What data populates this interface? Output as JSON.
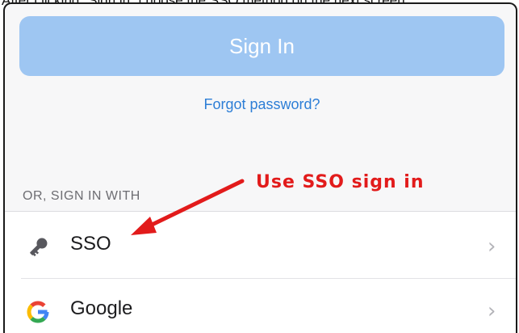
{
  "caption": "After clicking \"Sign in\" choose the SSO method on the next screen",
  "signin": {
    "button_label": "Sign In"
  },
  "forgot_password": "Forgot password?",
  "alt_signin": {
    "section_label": "OR, SIGN IN WITH",
    "providers": [
      {
        "label": "SSO",
        "icon": "key-icon"
      },
      {
        "label": "Google",
        "icon": "google-icon"
      }
    ]
  },
  "annotation": {
    "text": "Use SSO sign in",
    "color": "#e21b1b"
  },
  "colors": {
    "primary_button": "#9ec6f2",
    "link": "#2d7ed6",
    "background": "#f7f7f8",
    "chevron": "#b3b3b8"
  },
  "icons": {
    "chevron": "chevron-right-icon"
  }
}
